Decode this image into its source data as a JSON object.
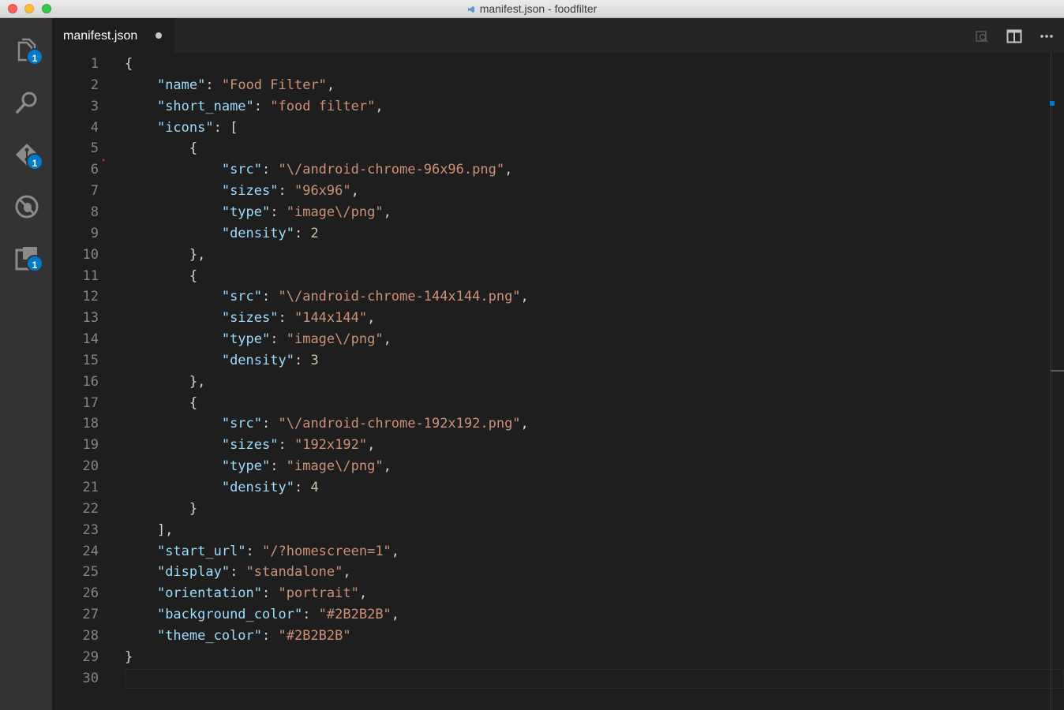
{
  "window": {
    "title": "manifest.json - foodfilter"
  },
  "activity_bar": {
    "items": [
      {
        "name": "explorer",
        "icon": "files-icon",
        "badge": "1"
      },
      {
        "name": "search",
        "icon": "search-icon",
        "badge": ""
      },
      {
        "name": "source-control",
        "icon": "git-icon",
        "badge": "1"
      },
      {
        "name": "debug",
        "icon": "debug-icon",
        "badge": ""
      },
      {
        "name": "extensions",
        "icon": "extensions-icon",
        "badge": "1"
      }
    ]
  },
  "tabs": [
    {
      "label": "manifest.json",
      "dirty": true
    }
  ],
  "editor_actions": [
    "open-preview-icon",
    "split-editor-icon",
    "more-actions-icon"
  ],
  "editor": {
    "language": "json",
    "lines": [
      [
        [
          "p",
          "{"
        ]
      ],
      [
        [
          "p",
          "    "
        ],
        [
          "k",
          "\"name\""
        ],
        [
          "p",
          ": "
        ],
        [
          "s",
          "\"Food Filter\""
        ],
        [
          "p",
          ","
        ]
      ],
      [
        [
          "p",
          "    "
        ],
        [
          "k",
          "\"short_name\""
        ],
        [
          "p",
          ": "
        ],
        [
          "s",
          "\"food filter\""
        ],
        [
          "p",
          ","
        ]
      ],
      [
        [
          "p",
          "    "
        ],
        [
          "k",
          "\"icons\""
        ],
        [
          "p",
          ": ["
        ]
      ],
      [
        [
          "p",
          "        {"
        ]
      ],
      [
        [
          "p",
          "            "
        ],
        [
          "k",
          "\"src\""
        ],
        [
          "p",
          ": "
        ],
        [
          "s",
          "\"\\/android-chrome-96x96.png\""
        ],
        [
          "p",
          ","
        ]
      ],
      [
        [
          "p",
          "            "
        ],
        [
          "k",
          "\"sizes\""
        ],
        [
          "p",
          ": "
        ],
        [
          "s",
          "\"96x96\""
        ],
        [
          "p",
          ","
        ]
      ],
      [
        [
          "p",
          "            "
        ],
        [
          "k",
          "\"type\""
        ],
        [
          "p",
          ": "
        ],
        [
          "s",
          "\"image\\/png\""
        ],
        [
          "p",
          ","
        ]
      ],
      [
        [
          "p",
          "            "
        ],
        [
          "k",
          "\"density\""
        ],
        [
          "p",
          ": "
        ],
        [
          "n",
          "2"
        ]
      ],
      [
        [
          "p",
          "        },"
        ]
      ],
      [
        [
          "p",
          "        {"
        ]
      ],
      [
        [
          "p",
          "            "
        ],
        [
          "k",
          "\"src\""
        ],
        [
          "p",
          ": "
        ],
        [
          "s",
          "\"\\/android-chrome-144x144.png\""
        ],
        [
          "p",
          ","
        ]
      ],
      [
        [
          "p",
          "            "
        ],
        [
          "k",
          "\"sizes\""
        ],
        [
          "p",
          ": "
        ],
        [
          "s",
          "\"144x144\""
        ],
        [
          "p",
          ","
        ]
      ],
      [
        [
          "p",
          "            "
        ],
        [
          "k",
          "\"type\""
        ],
        [
          "p",
          ": "
        ],
        [
          "s",
          "\"image\\/png\""
        ],
        [
          "p",
          ","
        ]
      ],
      [
        [
          "p",
          "            "
        ],
        [
          "k",
          "\"density\""
        ],
        [
          "p",
          ": "
        ],
        [
          "n",
          "3"
        ]
      ],
      [
        [
          "p",
          "        },"
        ]
      ],
      [
        [
          "p",
          "        {"
        ]
      ],
      [
        [
          "p",
          "            "
        ],
        [
          "k",
          "\"src\""
        ],
        [
          "p",
          ": "
        ],
        [
          "s",
          "\"\\/android-chrome-192x192.png\""
        ],
        [
          "p",
          ","
        ]
      ],
      [
        [
          "p",
          "            "
        ],
        [
          "k",
          "\"sizes\""
        ],
        [
          "p",
          ": "
        ],
        [
          "s",
          "\"192x192\""
        ],
        [
          "p",
          ","
        ]
      ],
      [
        [
          "p",
          "            "
        ],
        [
          "k",
          "\"type\""
        ],
        [
          "p",
          ": "
        ],
        [
          "s",
          "\"image\\/png\""
        ],
        [
          "p",
          ","
        ]
      ],
      [
        [
          "p",
          "            "
        ],
        [
          "k",
          "\"density\""
        ],
        [
          "p",
          ": "
        ],
        [
          "n",
          "4"
        ]
      ],
      [
        [
          "p",
          "        }"
        ]
      ],
      [
        [
          "p",
          "    ],"
        ]
      ],
      [
        [
          "p",
          "    "
        ],
        [
          "k",
          "\"start_url\""
        ],
        [
          "p",
          ": "
        ],
        [
          "s",
          "\"/?homescreen=1\""
        ],
        [
          "p",
          ","
        ]
      ],
      [
        [
          "p",
          "    "
        ],
        [
          "k",
          "\"display\""
        ],
        [
          "p",
          ": "
        ],
        [
          "s",
          "\"standalone\""
        ],
        [
          "p",
          ","
        ]
      ],
      [
        [
          "p",
          "    "
        ],
        [
          "k",
          "\"orientation\""
        ],
        [
          "p",
          ": "
        ],
        [
          "s",
          "\"portrait\""
        ],
        [
          "p",
          ","
        ]
      ],
      [
        [
          "p",
          "    "
        ],
        [
          "k",
          "\"background_color\""
        ],
        [
          "p",
          ": "
        ],
        [
          "s",
          "\"#2B2B2B\""
        ],
        [
          "p",
          ","
        ]
      ],
      [
        [
          "p",
          "    "
        ],
        [
          "k",
          "\"theme_color\""
        ],
        [
          "p",
          ": "
        ],
        [
          "s",
          "\"#2B2B2B\""
        ]
      ],
      [
        [
          "p",
          "}"
        ]
      ],
      [
        [
          "p",
          ""
        ]
      ]
    ],
    "current_line": 30
  },
  "colors": {
    "accent": "#007acc",
    "key": "#9cdcfe",
    "string": "#ce9178",
    "number": "#b5cea8",
    "editor_bg": "#1e1e1e"
  }
}
